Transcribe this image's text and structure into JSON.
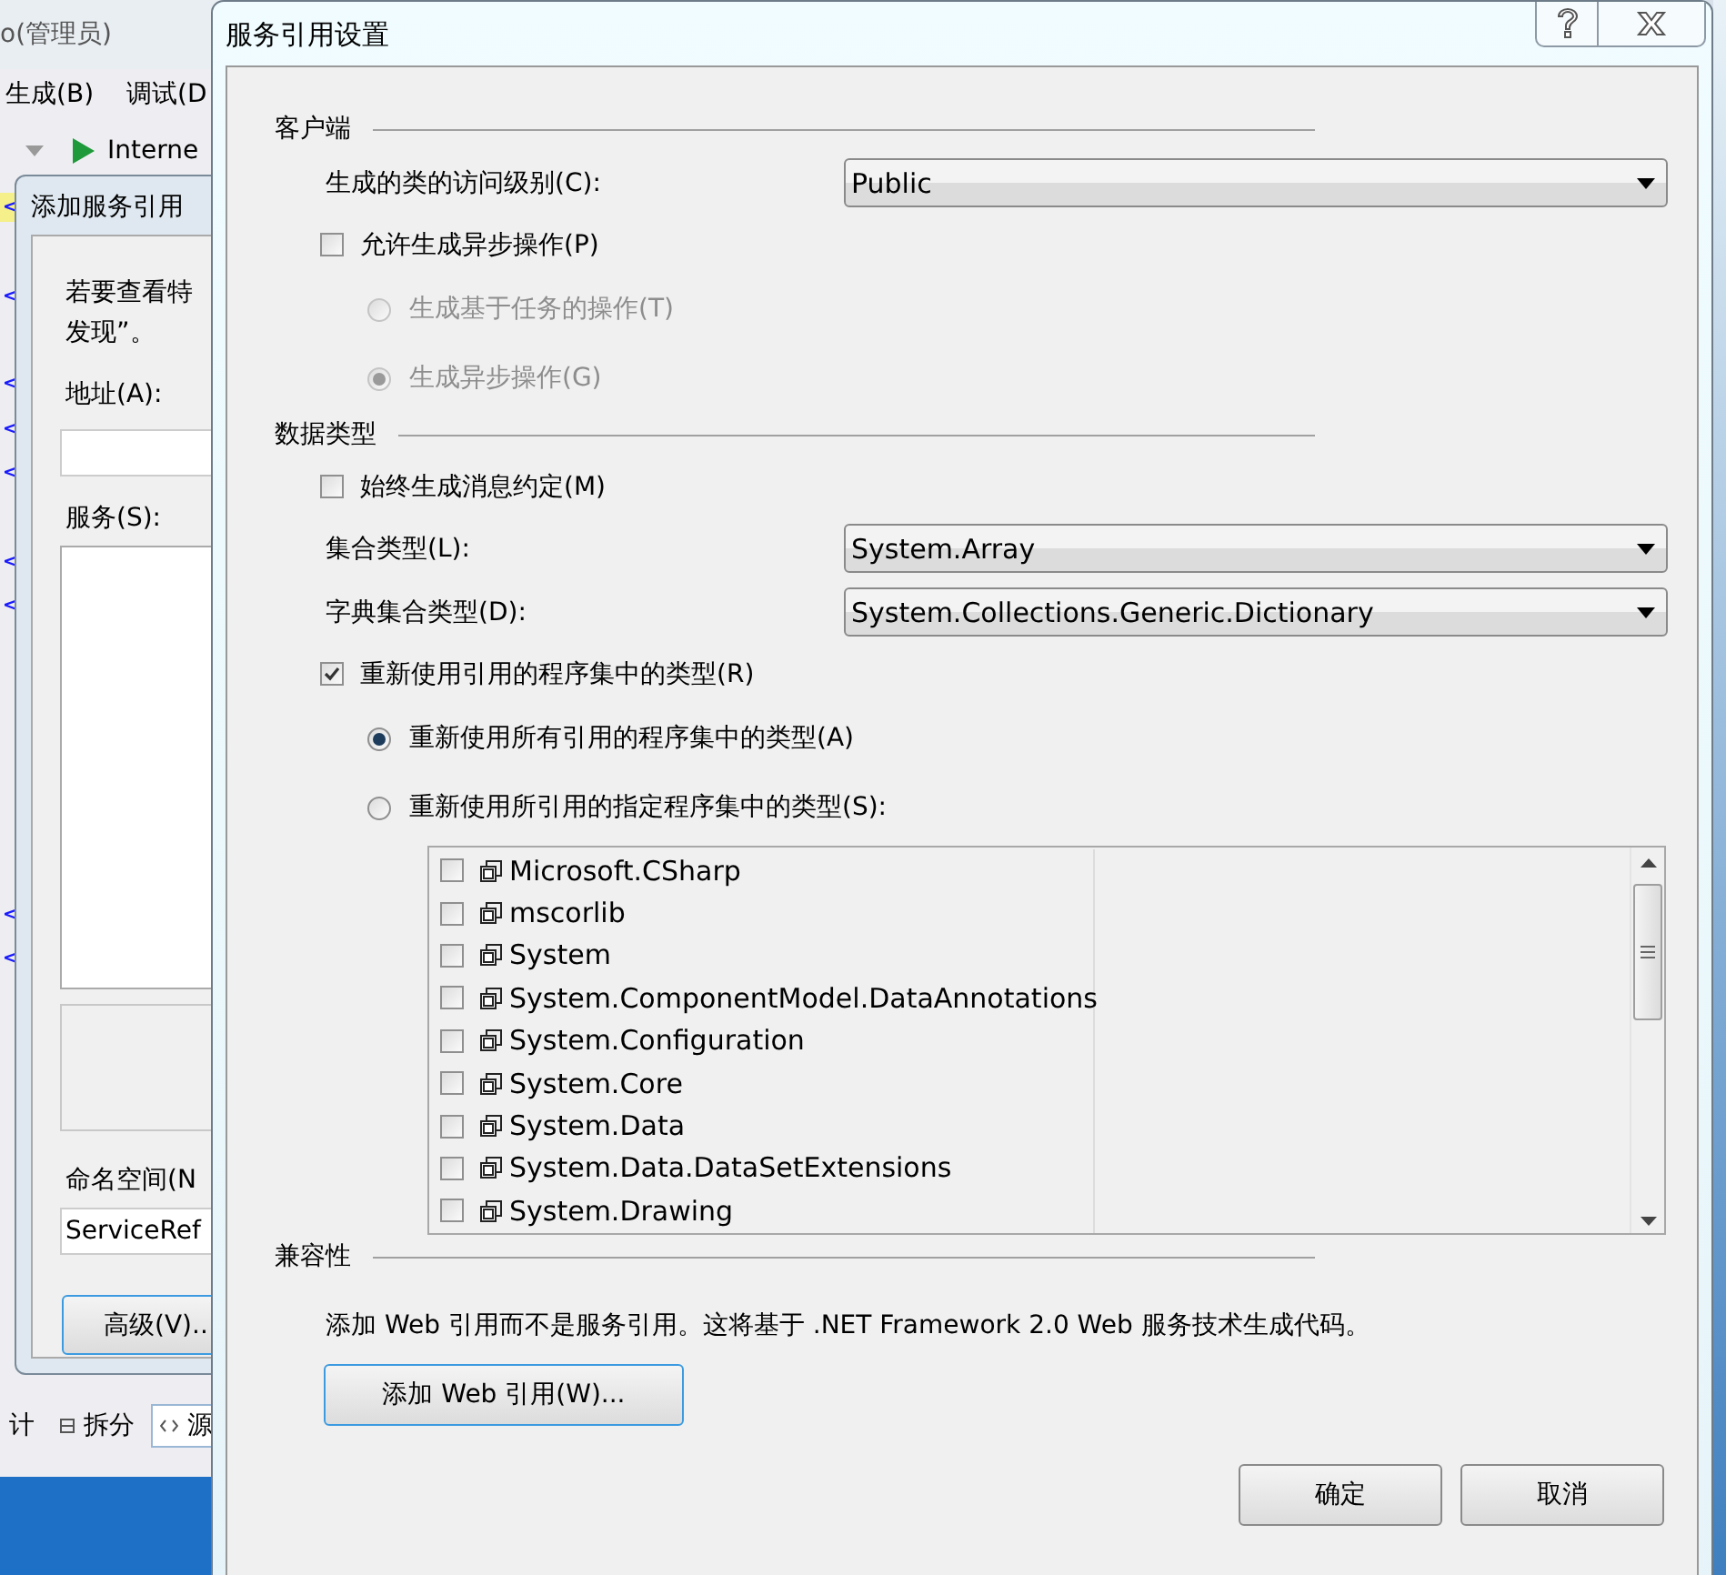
{
  "ide": {
    "title": "o(管理员)",
    "menus": [
      "生成(B)",
      "调试(D"
    ],
    "run_label": "Interne",
    "code_lines": [
      {
        "kind": "tag",
        "text": "<",
        "highlighted": true
      },
      {
        "kind": "blank"
      },
      {
        "kind": "tag",
        "text": "<",
        "highlighted": false
      },
      {
        "kind": "blank"
      },
      {
        "kind": "tag",
        "text": "<",
        "highlighted": false
      },
      {
        "kind": "tag",
        "text": "<",
        "highlighted": false
      },
      {
        "kind": "tag",
        "text": "<",
        "highlighted": false
      },
      {
        "kind": "blank"
      },
      {
        "kind": "tag",
        "text": "<",
        "highlighted": false
      },
      {
        "kind": "tag",
        "text": "<",
        "highlighted": false
      },
      {
        "kind": "blank"
      },
      {
        "kind": "blank"
      },
      {
        "kind": "blank"
      },
      {
        "kind": "blank"
      },
      {
        "kind": "blank"
      },
      {
        "kind": "blank"
      },
      {
        "kind": "tag",
        "text": "<",
        "highlighted": false
      },
      {
        "kind": "tag",
        "text": "<",
        "highlighted": false
      }
    ],
    "view_tabs": [
      {
        "kind": "plain",
        "label": "计",
        "selected": false
      },
      {
        "kind": "split",
        "label": "拆分",
        "selected": false
      },
      {
        "kind": "source",
        "label": "源",
        "selected": true
      }
    ]
  },
  "add_service_dialog": {
    "title": "添加服务引用",
    "intro": [
      "若要查看特",
      "发现”。"
    ],
    "address_label": "地址(A):",
    "services_label": "服务(S):",
    "namespace_label": "命名空间(N",
    "namespace_value": "ServiceRef",
    "advanced_button": "高级(V).."
  },
  "settings_dialog": {
    "title": "服务引用设置",
    "sections": [
      {
        "title": "客户端",
        "rows": [
          {
            "kind": "dropdown",
            "label": "生成的类的访问级别(C):",
            "value": "Public"
          },
          {
            "kind": "checkbox",
            "label": "允许生成异步操作(P)",
            "checked": false
          },
          {
            "kind": "radio",
            "label": "生成基于任务的操作(T)",
            "selected": false,
            "disabled": true
          },
          {
            "kind": "radio",
            "label": "生成异步操作(G)",
            "selected": true,
            "disabled": true
          }
        ]
      },
      {
        "title": "数据类型",
        "rows": [
          {
            "kind": "checkbox",
            "label": "始终生成消息约定(M)",
            "checked": false
          },
          {
            "kind": "dropdown",
            "label": "集合类型(L):",
            "value": "System.Array"
          },
          {
            "kind": "dropdown",
            "label": "字典集合类型(D):",
            "value": "System.Collections.Generic.Dictionary"
          },
          {
            "kind": "checkbox",
            "label": "重新使用引用的程序集中的类型(R)",
            "checked": true
          },
          {
            "kind": "radio",
            "label": "重新使用所有引用的程序集中的类型(A)",
            "selected": true,
            "disabled": false
          },
          {
            "kind": "radio",
            "label": "重新使用所引用的指定程序集中的类型(S):",
            "selected": false,
            "disabled": false
          },
          {
            "kind": "assembly_list",
            "items": [
              {
                "name": "Microsoft.CSharp",
                "checked": false
              },
              {
                "name": "mscorlib",
                "checked": false
              },
              {
                "name": "System",
                "checked": false
              },
              {
                "name": "System.ComponentModel.DataAnnotations",
                "checked": false
              },
              {
                "name": "System.Configuration",
                "checked": false
              },
              {
                "name": "System.Core",
                "checked": false
              },
              {
                "name": "System.Data",
                "checked": false
              },
              {
                "name": "System.Data.DataSetExtensions",
                "checked": false
              },
              {
                "name": "System.Drawing",
                "checked": false
              }
            ]
          }
        ]
      },
      {
        "title": "兼容性",
        "rows": [
          {
            "kind": "note",
            "text": "添加 Web 引用而不是服务引用。这将基于 .NET Framework 2.0 Web 服务技术生成代码。"
          },
          {
            "kind": "button",
            "label": "添加 Web 引用(W)..."
          }
        ]
      }
    ],
    "buttons": [
      "确定",
      "取消"
    ]
  }
}
